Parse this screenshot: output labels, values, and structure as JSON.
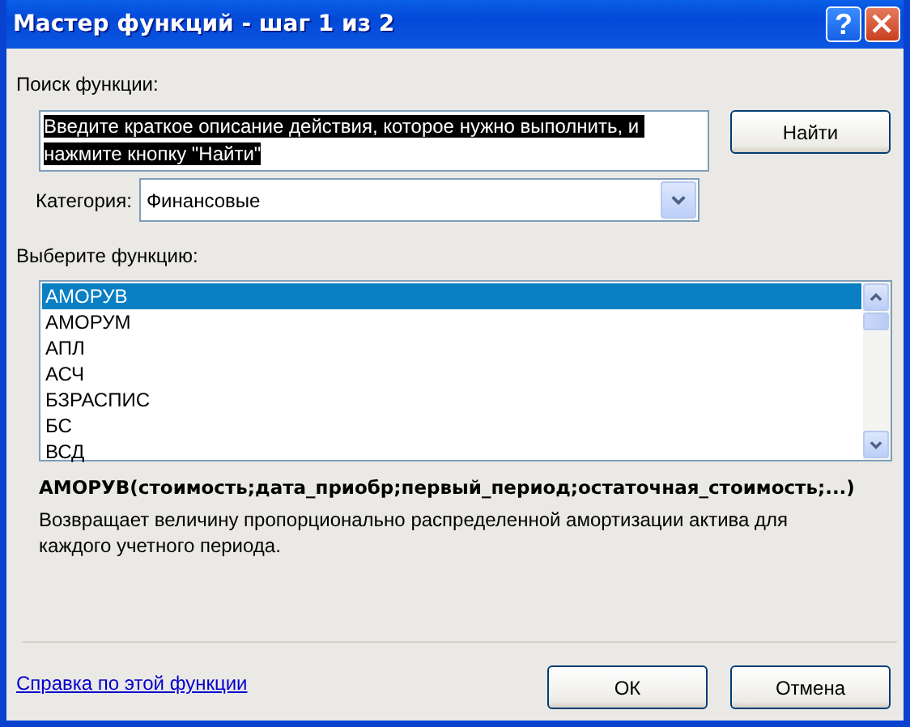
{
  "window": {
    "title": "Мастер функций - шаг 1 из 2",
    "buttons": [
      "?"
    ]
  },
  "search": {
    "label": "Поиск функции:",
    "value": "Введите краткое описание действия, которое нужно выполнить, и нажмите кнопку \"Найти\"",
    "text_selected": true,
    "button": "Найти"
  },
  "category": {
    "label": "Категория:",
    "value": "Финансовые"
  },
  "functions": {
    "label": "Выберите функцию:",
    "items": [
      {
        "name": "АМОРУВ",
        "selected": true
      },
      {
        "name": "АМОРУМ",
        "selected": false
      },
      {
        "name": "АПЛ",
        "selected": false
      },
      {
        "name": "АСЧ",
        "selected": false
      },
      {
        "name": "БЗРАСПИС",
        "selected": false
      },
      {
        "name": "БС",
        "selected": false
      },
      {
        "name": "ВСД",
        "selected": false
      }
    ]
  },
  "signature": "АМОРУВ(стоимость;дата_приобр;первый_период;остаточная_стоимость;...)",
  "description": "Возвращает величину пропорционально распределенной амортизации актива для каждого учетного периода.",
  "help_link": "Справка по этой функции",
  "buttons": [
    "ОК",
    "Отмена"
  ]
}
